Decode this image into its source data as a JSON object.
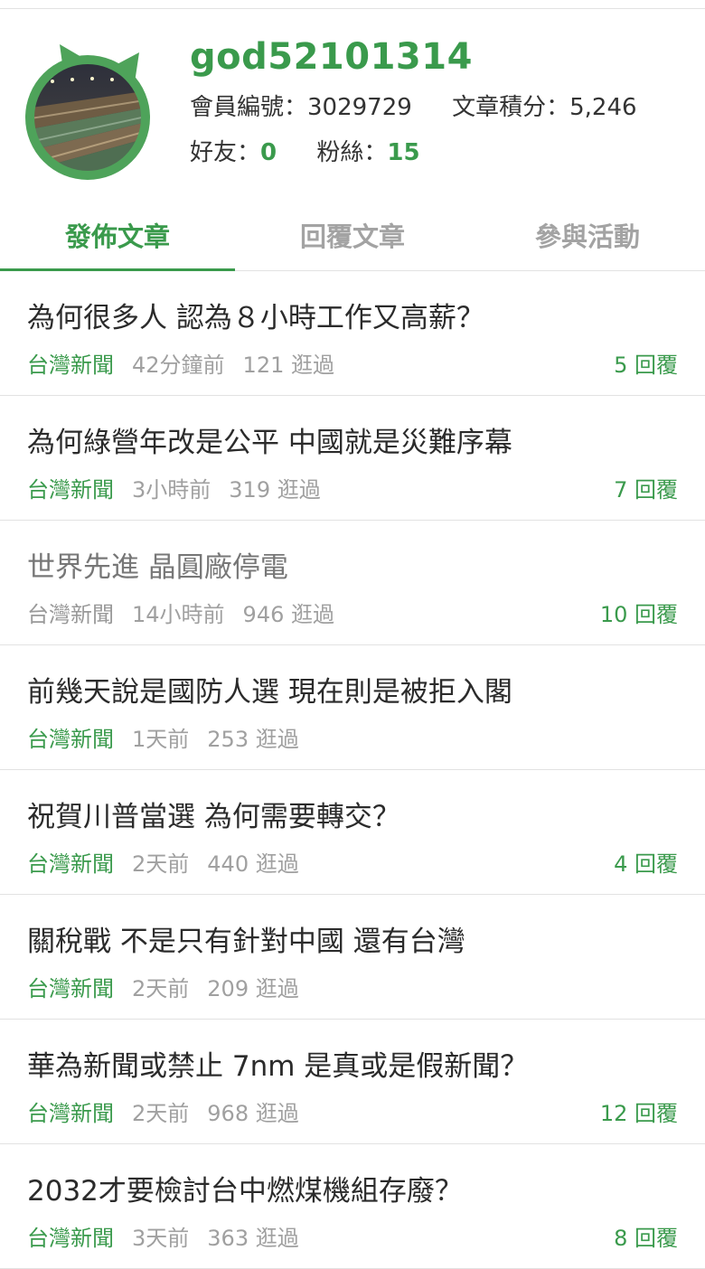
{
  "profile": {
    "username": "god52101314",
    "member_id_label": "會員編號：",
    "member_id": "3029729",
    "score_label": "文章積分：",
    "score": "5,246",
    "friends_label": "好友：",
    "friends": "0",
    "fans_label": "粉絲：",
    "fans": "15",
    "avatar_icon": "avatar-photo-icon"
  },
  "tabs": [
    {
      "label": "發佈文章",
      "active": true
    },
    {
      "label": "回覆文章",
      "active": false
    },
    {
      "label": "參與活動",
      "active": false
    }
  ],
  "posts": [
    {
      "title": "為何很多人 認為８小時工作又高薪？",
      "board": "台灣新聞",
      "time": "42分鐘前",
      "views": "121 逛過",
      "replies": "5 回覆"
    },
    {
      "title": "為何綠營年改是公平 中國就是災難序幕",
      "board": "台灣新聞",
      "time": "3小時前",
      "views": "319 逛過",
      "replies": "7 回覆"
    },
    {
      "title": "世界先進 晶圓廠停電",
      "board": "台灣新聞",
      "time": "14小時前",
      "views": "946 逛過",
      "replies": "10 回覆"
    },
    {
      "title": "前幾天說是國防人選 現在則是被拒入閣",
      "board": "台灣新聞",
      "time": "1天前",
      "views": "253 逛過",
      "replies": ""
    },
    {
      "title": "祝賀川普當選 為何需要轉交？",
      "board": "台灣新聞",
      "time": "2天前",
      "views": "440 逛過",
      "replies": "4 回覆"
    },
    {
      "title": "關稅戰 不是只有針對中國 還有台灣",
      "board": "台灣新聞",
      "time": "2天前",
      "views": "209 逛過",
      "replies": ""
    },
    {
      "title": "華為新聞或禁止 7nm 是真或是假新聞？",
      "board": "台灣新聞",
      "time": "2天前",
      "views": "968 逛過",
      "replies": "12 回覆"
    },
    {
      "title": "2032才要檢討台中燃煤機組存廢？",
      "board": "台灣新聞",
      "time": "3天前",
      "views": "363 逛過",
      "replies": "8 回覆"
    }
  ],
  "colors": {
    "accent": "#3a9a4c",
    "muted": "#a0a0a0",
    "divider": "#e2e2e2"
  }
}
